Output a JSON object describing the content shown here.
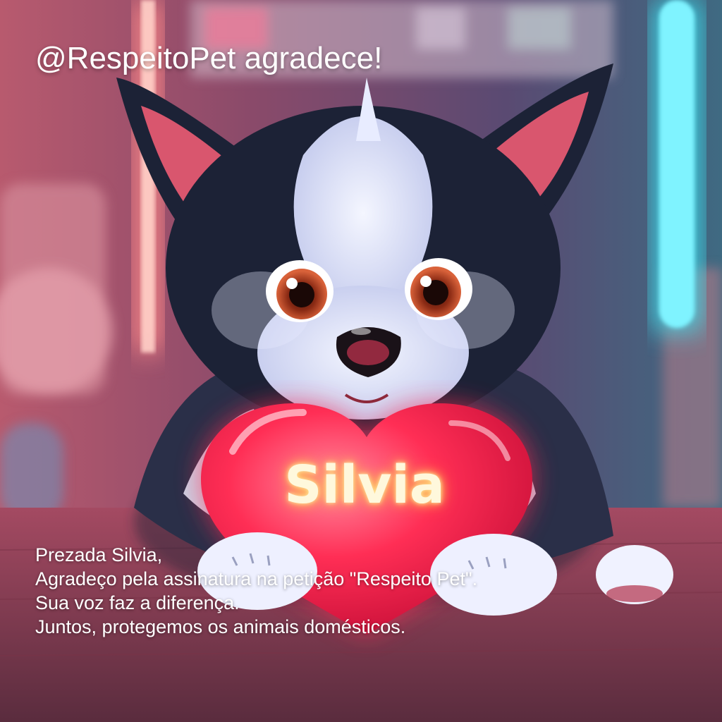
{
  "header": {
    "text": "@RespeitoPet agradece!"
  },
  "heart": {
    "name": "Silvia"
  },
  "message": {
    "lines": [
      "Prezada Silvia,",
      "Agradeço pela assinatura na petição \"Respeito Pet\".",
      "Sua voz faz a diferença.",
      "Juntos, protegemos os animais domésticos."
    ]
  },
  "colors": {
    "neon_cyan": "#3ee6f5",
    "neon_pink": "#ff6b8a",
    "heart_red": "#ff2e55",
    "fur_dark": "#1c2236",
    "fur_light": "#e8ecff",
    "text_white": "#ffffff",
    "glow_text": "#fff3c4"
  }
}
